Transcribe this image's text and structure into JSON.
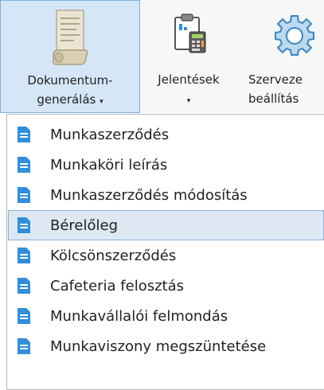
{
  "ribbon": {
    "dokumentum": {
      "label_line1": "Dokumentum-",
      "label_line2": "generálás",
      "caret": "▾",
      "icon": "document-scroll-icon"
    },
    "jelentesek": {
      "label_line1": "Jelentések",
      "caret": "▾",
      "icon": "report-calculator-icon"
    },
    "szervezet": {
      "label_line1": "Szerveze",
      "label_line2": "beállítás",
      "icon": "gear-icon"
    }
  },
  "menu": {
    "items": [
      {
        "label": "Munkaszerződés",
        "icon": "document-icon"
      },
      {
        "label": "Munkaköri leírás",
        "icon": "document-icon"
      },
      {
        "label": "Munkaszerződés módosítás",
        "icon": "document-icon"
      },
      {
        "label": "Bérelőleg",
        "icon": "document-icon",
        "highlighted": true
      },
      {
        "label": "Kölcsönszerződés",
        "icon": "document-icon"
      },
      {
        "label": "Cafeteria felosztás",
        "icon": "document-icon"
      },
      {
        "label": "Munkavállalói felmondás",
        "icon": "document-icon"
      },
      {
        "label": "Munkaviszony megszüntetése",
        "icon": "document-icon"
      }
    ]
  },
  "colors": {
    "accent_icon": "#2f8fdc",
    "highlight_bg": "#dde8f3",
    "active_button_bg": "#d5e6f7"
  }
}
